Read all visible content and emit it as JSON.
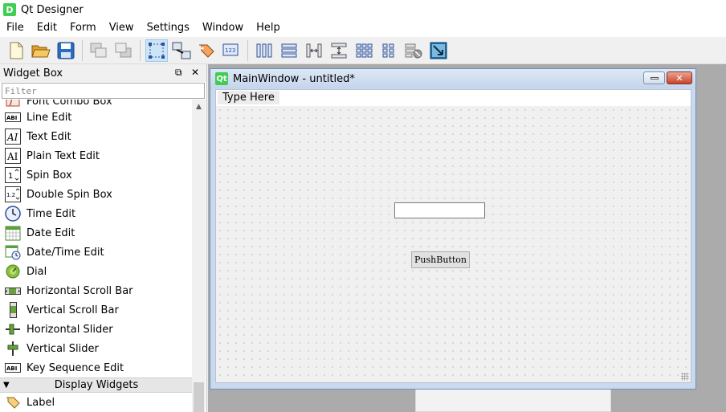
{
  "app": {
    "title": "Qt Designer",
    "icon_letter": "D"
  },
  "menubar": {
    "items": [
      "File",
      "Edit",
      "Form",
      "View",
      "Settings",
      "Window",
      "Help"
    ]
  },
  "toolbar": {
    "icons": [
      "new-file-icon",
      "open-folder-icon",
      "save-icon",
      "send-to-back-icon",
      "bring-to-front-icon",
      "edit-widgets-icon",
      "edit-signals-slots-icon",
      "edit-buddies-icon",
      "edit-tab-order-icon",
      "layout-horizontal-icon",
      "layout-vertical-icon",
      "layout-horizontal-splitter-icon",
      "layout-vertical-splitter-icon",
      "layout-grid-icon",
      "layout-form-icon",
      "break-layout-icon",
      "adjust-size-icon"
    ]
  },
  "widget_box": {
    "title": "Widget Box",
    "filter_placeholder": "Filter",
    "items": [
      {
        "label": "Font Combo Box",
        "icon": "font-combo-box-icon"
      },
      {
        "label": "Line Edit",
        "icon": "line-edit-icon"
      },
      {
        "label": "Text Edit",
        "icon": "text-edit-icon"
      },
      {
        "label": "Plain Text Edit",
        "icon": "plain-text-edit-icon"
      },
      {
        "label": "Spin Box",
        "icon": "spin-box-icon"
      },
      {
        "label": "Double Spin Box",
        "icon": "double-spin-box-icon"
      },
      {
        "label": "Time Edit",
        "icon": "time-edit-icon"
      },
      {
        "label": "Date Edit",
        "icon": "date-edit-icon"
      },
      {
        "label": "Date/Time Edit",
        "icon": "date-time-edit-icon"
      },
      {
        "label": "Dial",
        "icon": "dial-icon"
      },
      {
        "label": "Horizontal Scroll Bar",
        "icon": "horizontal-scroll-bar-icon"
      },
      {
        "label": "Vertical Scroll Bar",
        "icon": "vertical-scroll-bar-icon"
      },
      {
        "label": "Horizontal Slider",
        "icon": "horizontal-slider-icon"
      },
      {
        "label": "Vertical Slider",
        "icon": "vertical-slider-icon"
      },
      {
        "label": "Key Sequence Edit",
        "icon": "key-sequence-edit-icon"
      }
    ],
    "category": "Display Widgets",
    "after_category": [
      {
        "label": "Label",
        "icon": "label-icon"
      }
    ]
  },
  "main_window": {
    "title": "MainWindow - untitled*",
    "icon_text": "Qt",
    "form_menu_placeholder": "Type Here",
    "push_button_label": "PushButton"
  },
  "colors": {
    "qt_green": "#41cd52",
    "mdi_background": "#ababab",
    "active_tool_bg": "#cce4f7"
  }
}
